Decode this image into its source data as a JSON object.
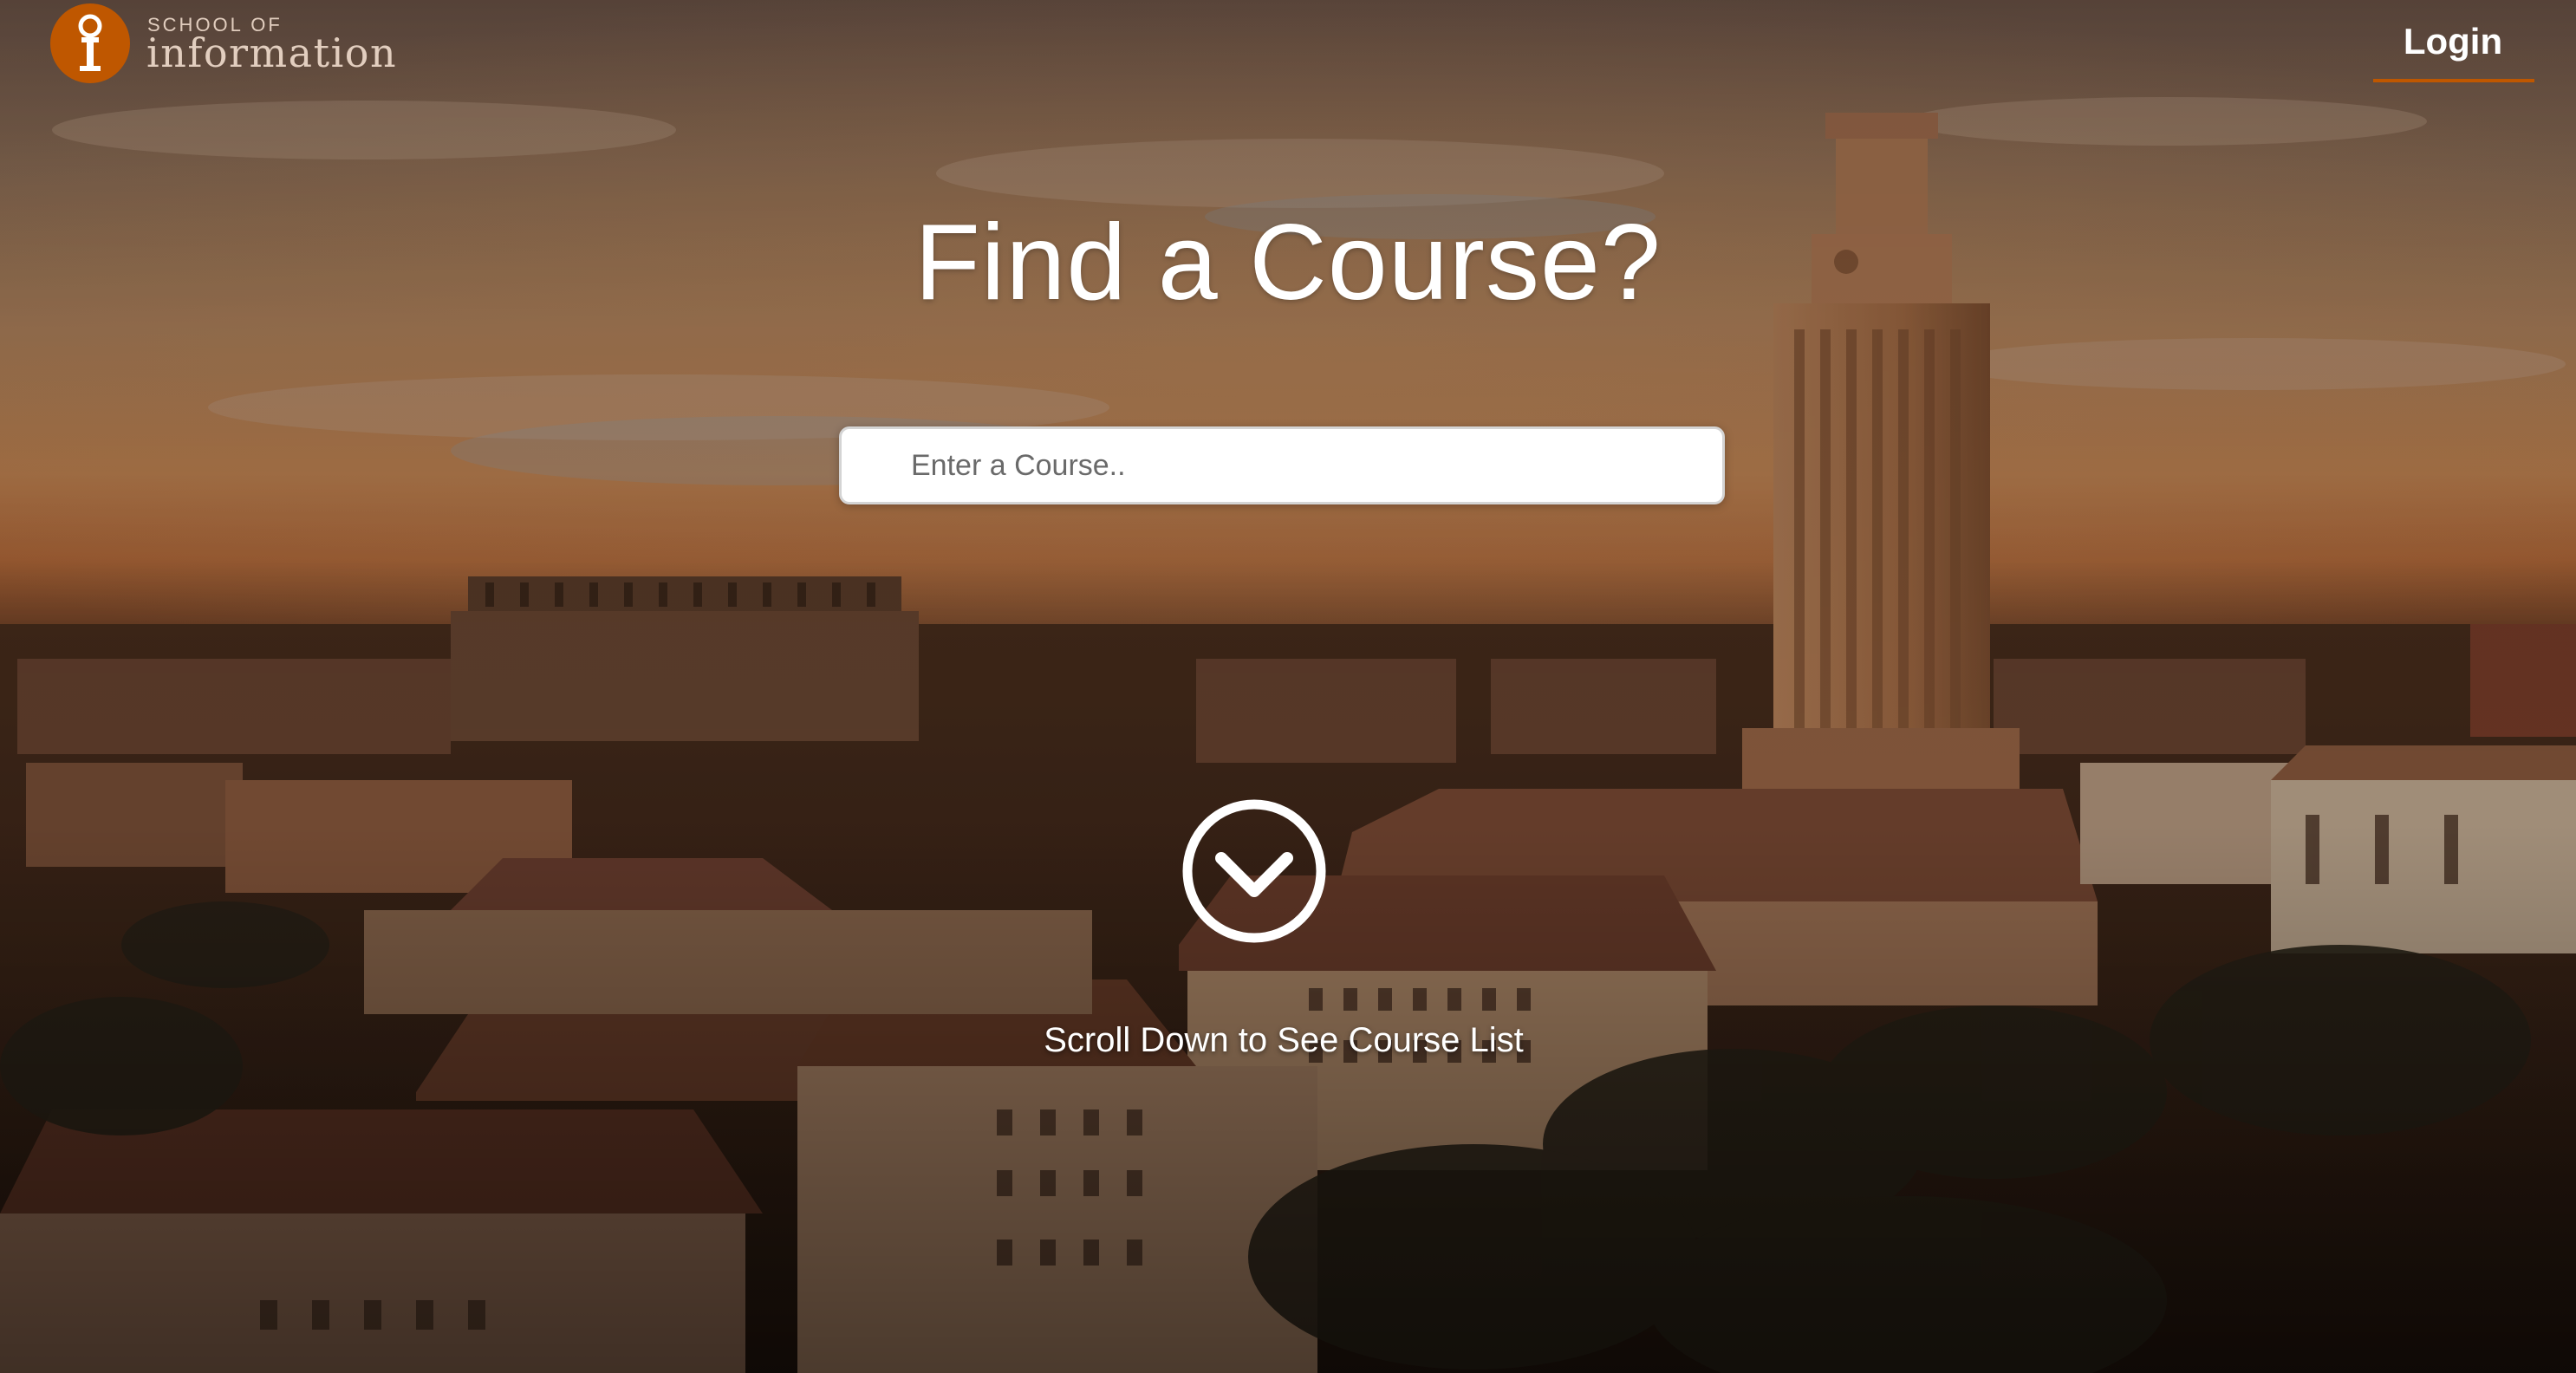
{
  "header": {
    "logo": {
      "icon": "school-of-information-logo-icon",
      "small_text": "SCHOOL OF",
      "large_text": "information"
    },
    "login_label": "Login"
  },
  "hero": {
    "title": "Find a Course?",
    "search_placeholder": "Enter a Course..",
    "scroll_icon": "chevron-down-circle-icon",
    "scroll_text": "Scroll Down to See Course List"
  },
  "colors": {
    "accent": "#bf5700",
    "text": "#ffffff"
  }
}
